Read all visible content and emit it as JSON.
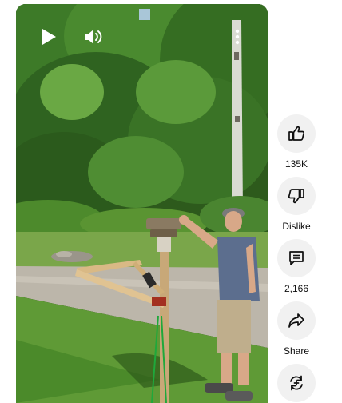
{
  "player": {
    "controls": {
      "play_icon": "play-icon",
      "volume_icon": "volume-icon",
      "more_icon": "more-vert-icon"
    }
  },
  "actions": {
    "like": {
      "icon": "thumb-up-icon",
      "label": "135K"
    },
    "dislike": {
      "icon": "thumb-down-icon",
      "label": "Dislike"
    },
    "comments": {
      "icon": "comment-icon",
      "label": "2,166"
    },
    "share": {
      "icon": "share-icon",
      "label": "Share"
    },
    "remix": {
      "icon": "remix-icon",
      "label": ""
    }
  },
  "colors": {
    "action_circle": "#f1f1f1",
    "text": "#0f0f0f",
    "page_bg": "#ffffff"
  }
}
